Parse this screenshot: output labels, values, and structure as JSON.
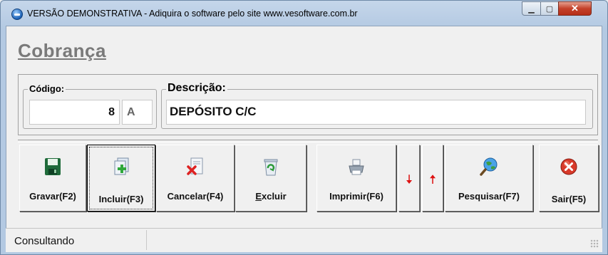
{
  "window": {
    "title": "VERSÃO DEMONSTRATIVA - Adiquira o software pelo site www.vesoftware.com.br",
    "icon": "app-globe-icon",
    "controls": [
      "minimize-icon",
      "maximize-icon",
      "close-icon"
    ]
  },
  "page": {
    "title": "Cobrança"
  },
  "form": {
    "codigo": {
      "label": "Código:",
      "value": "8",
      "suffix": "A"
    },
    "descricao": {
      "label": "Descrição:",
      "value": "DEPÓSITO C/C"
    }
  },
  "toolbar": {
    "gravar": "Gravar(F2)",
    "incluir": "Incluir(F3)",
    "cancelar": "Cancelar(F4)",
    "excluir": "Excluir",
    "imprimir": "Imprimir(F6)",
    "down_arrow": "🠇",
    "up_arrow": "🠅",
    "pesquisar": "Pesquisar(F7)",
    "sair": "Sair(F5)"
  },
  "status": {
    "text": "Consultando"
  },
  "colors": {
    "accent_red": "#d11111",
    "title_gray": "#7a7a7a"
  }
}
